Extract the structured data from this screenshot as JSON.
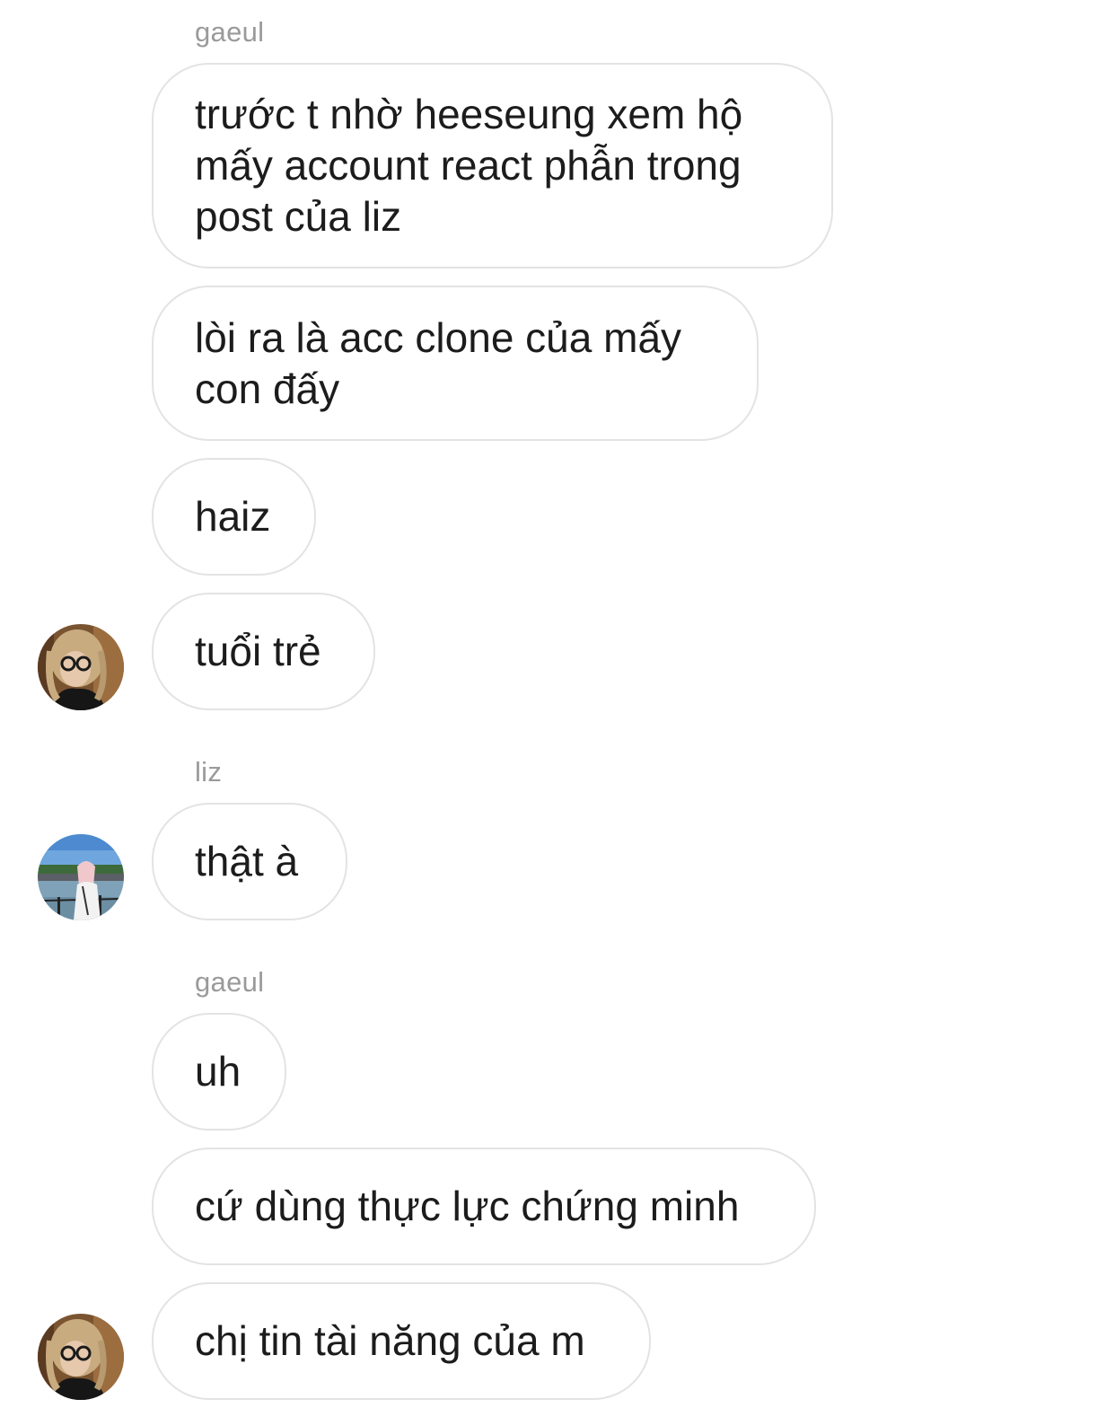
{
  "thread": {
    "groups": [
      {
        "sender": "gaeul",
        "messages": [
          "trước t nhờ heeseung xem hộ\nmấy account react phẫn trong\npost của liz",
          "lòi ra là acc clone của mấy\ncon đấy",
          "haiz",
          "tuổi trẻ"
        ]
      },
      {
        "sender": "liz",
        "messages": [
          "thật à"
        ]
      },
      {
        "sender": "gaeul",
        "messages": [
          "uh",
          "cứ dùng thực lực chứng minh",
          "chị tin tài năng của m"
        ]
      }
    ]
  },
  "avatars": {
    "gaeul": "avatar-gaeul",
    "liz": "avatar-liz"
  },
  "colors": {
    "bubble_border": "#e3e3e3",
    "sender_text": "#9a9a9a",
    "message_text": "#1c1c1c"
  }
}
